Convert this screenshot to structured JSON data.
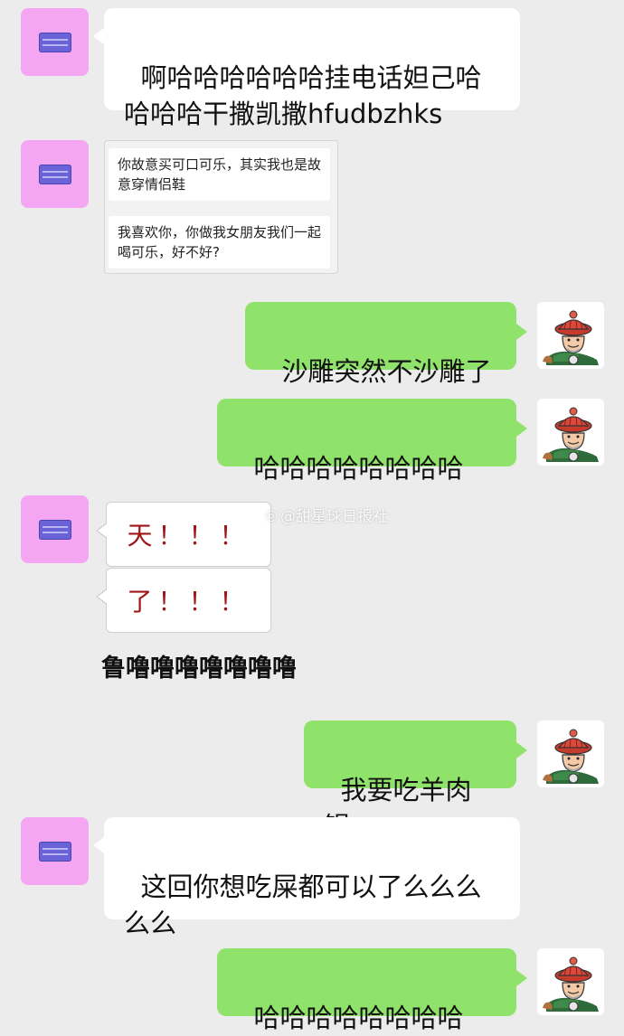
{
  "messages": {
    "m1_text": "啊哈哈哈哈哈哈挂电话妲己哈哈哈哈干撒凯撒hfudbzhks",
    "m2_q1": "你故意买可口可乐，其实我也是故意穿情侣鞋",
    "m2_q2": "我喜欢你，你做我女朋友我们一起喝可乐，好不好?",
    "m3_text": "沙雕突然不沙雕了",
    "m4_text": "哈哈哈哈哈哈哈哈",
    "m5_sticker1": "天！！！",
    "m5_sticker2": "了！！！",
    "m5_stutter": "鲁噜噜噜噜噜噜噜",
    "m6_text": "我要吃羊肉锅",
    "m7_text": "这回你想吃屎都可以了么么么么么",
    "m8_text": "哈哈哈哈哈哈哈哈"
  },
  "watermark": {
    "text": "@甜星球日报社",
    "icon": "weibo-icon"
  },
  "colors": {
    "background": "#ececec",
    "sent_bubble": "#8fe36a",
    "received_bubble": "#ffffff",
    "left_avatar": "#f5a6f2",
    "sticker_text": "#a01616"
  },
  "avatars": {
    "left_icon": "id-card-icon",
    "right_icon": "qing-official-cartoon-avatar"
  }
}
